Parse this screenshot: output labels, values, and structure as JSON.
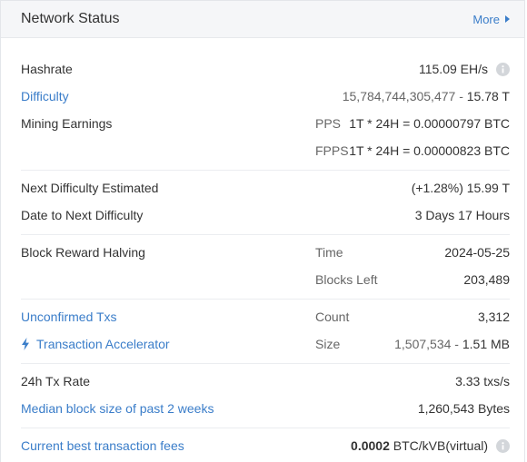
{
  "header": {
    "title": "Network Status",
    "more": "More"
  },
  "hashrate": {
    "label": "Hashrate",
    "value": "115.09 EH/s"
  },
  "difficulty": {
    "label": "Difficulty",
    "value_raw": "15,784,744,305,477",
    "value_sep": " - ",
    "value_short": "15.78 T"
  },
  "mining": {
    "label": "Mining Earnings",
    "pps_label": "PPS",
    "pps_value": "1T * 24H = 0.00000797 BTC",
    "fpps_label": "FPPS",
    "fpps_value": "1T * 24H = 0.00000823 BTC"
  },
  "next_difficulty": {
    "label": "Next Difficulty Estimated",
    "value": "(+1.28%) 15.99 T"
  },
  "date_next": {
    "label": "Date to Next Difficulty",
    "value": "3 Days 17 Hours"
  },
  "halving": {
    "label": "Block Reward Halving",
    "time_label": "Time",
    "time_value": "2024-05-25",
    "blocks_label": "Blocks Left",
    "blocks_value": "203,489"
  },
  "unconfirmed": {
    "label": "Unconfirmed Txs",
    "count_label": "Count",
    "count_value": "3,312"
  },
  "accelerator": {
    "label": "Transaction Accelerator",
    "size_label": "Size",
    "size_raw": "1,507,534",
    "size_sep": " - ",
    "size_short": "1.51 MB"
  },
  "tx_rate": {
    "label": "24h Tx Rate",
    "value": "3.33 txs/s"
  },
  "median_block": {
    "label": "Median block size of past 2 weeks",
    "value": "1,260,543 Bytes"
  },
  "fees": {
    "label": "Current best transaction fees",
    "value_bold": "0.0002",
    "value_unit": " BTC/kVB(virtual)"
  },
  "colors": {
    "link": "#3a7dc9",
    "text": "#333333",
    "muted": "#666666",
    "header_bg": "#f5f6f8"
  },
  "icons": {
    "info": "info-icon",
    "bolt": "lightning-bolt-icon",
    "more": "caret-right-icon"
  }
}
